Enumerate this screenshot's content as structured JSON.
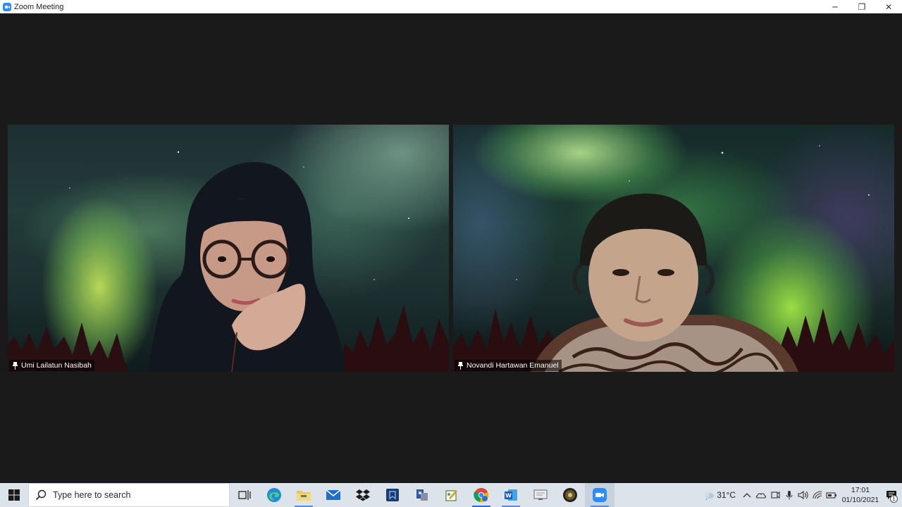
{
  "window": {
    "title": "Zoom Meeting",
    "minimize_glyph": "─",
    "restore_glyph": "❐",
    "close_glyph": "✕"
  },
  "participants": [
    {
      "name": "Umi Lailatun Nasibah",
      "icon": "pin-icon"
    },
    {
      "name": "Novandi Hartawan Emanuel",
      "icon": "pin-icon"
    }
  ],
  "taskbar": {
    "search_placeholder": "Type here to search",
    "apps": [
      {
        "name": "task-view-icon"
      },
      {
        "name": "edge-icon"
      },
      {
        "name": "file-explorer-icon"
      },
      {
        "name": "mail-icon"
      },
      {
        "name": "dropbox-icon"
      },
      {
        "name": "books-app-icon"
      },
      {
        "name": "blue-app-icon"
      },
      {
        "name": "notes-app-icon"
      },
      {
        "name": "chrome-icon"
      },
      {
        "name": "word-icon"
      },
      {
        "name": "screen-app-icon"
      },
      {
        "name": "game-app-icon"
      },
      {
        "name": "zoom-icon"
      }
    ],
    "weather": "31°C",
    "time": "17:01",
    "date": "01/10/2021",
    "notification_count": "1"
  },
  "colors": {
    "meeting_bg": "#1a1a1a",
    "taskbar_bg": "#dde3ea",
    "zoom_blue": "#2d8cff"
  }
}
